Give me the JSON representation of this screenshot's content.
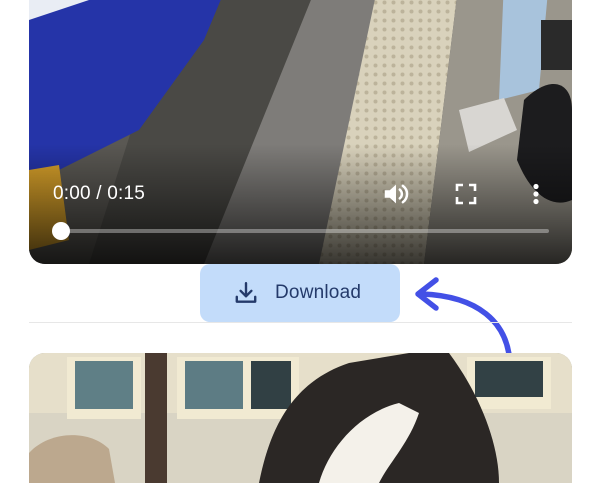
{
  "player": {
    "time_display": "0:00 / 0:15",
    "current_time": "0:00",
    "duration": "0:15",
    "progress_fraction": 0.0,
    "controls": {
      "volume_icon": "volume-high-icon",
      "fullscreen_icon": "fullscreen-icon",
      "more_icon": "more-vertical-icon"
    }
  },
  "download": {
    "label": "Download",
    "icon": "download-icon"
  },
  "annotation": {
    "icon": "curved-arrow-icon",
    "color": "#4350e6"
  },
  "colors": {
    "download_bg": "#c3dcfa",
    "download_text": "#243a6a"
  }
}
